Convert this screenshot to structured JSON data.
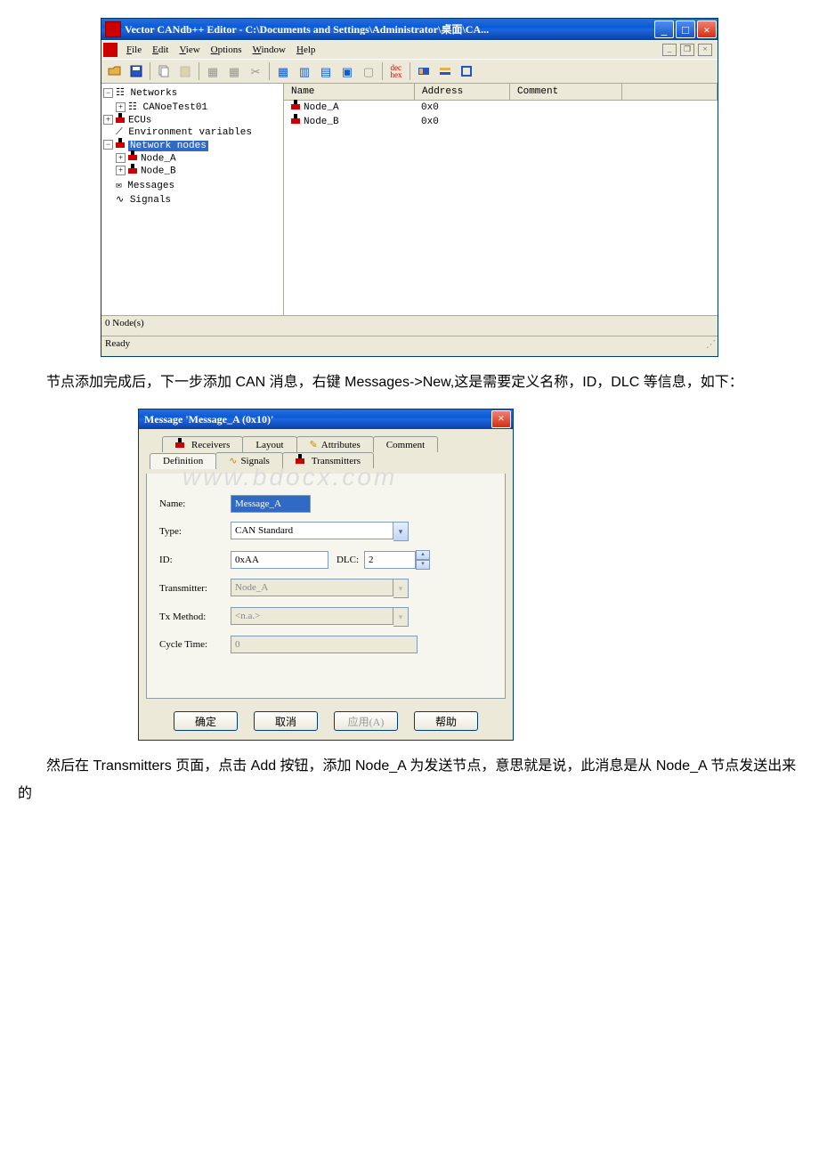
{
  "editor": {
    "title": "Vector CANdb++ Editor - C:\\Documents and Settings\\Administrator\\桌面\\CA...",
    "menus": {
      "file": "File",
      "edit": "Edit",
      "view": "View",
      "options": "Options",
      "window": "Window",
      "help": "Help"
    },
    "tree": {
      "networks": "Networks",
      "canoetest": "CANoeTest01",
      "ecus": "ECUs",
      "env": "Environment variables",
      "netnodes": "Network nodes",
      "node_a": "Node_A",
      "node_b": "Node_B",
      "msgs": "Messages",
      "sigs": "Signals"
    },
    "list": {
      "h_name": "Name",
      "h_addr": "Address",
      "h_comm": "Comment",
      "rows": [
        {
          "name": "Node_A",
          "addr": "0x0"
        },
        {
          "name": "Node_B",
          "addr": "0x0"
        }
      ]
    },
    "status_nodes": "0  Node(s)",
    "status_ready": "Ready"
  },
  "para1": "节点添加完成后，下一步添加 CAN 消息，右键 Messages->New,这是需要定义名称，ID，DLC 等信息，如下：",
  "dialog": {
    "title": "Message 'Message_A (0x10)'",
    "tabs": {
      "receivers": "Receivers",
      "layout": "Layout",
      "attributes": "Attributes",
      "comment": "Comment",
      "definition": "Definition",
      "signals": "Signals",
      "transmitters": "Transmitters"
    },
    "labels": {
      "name": "Name:",
      "type": "Type:",
      "id": "ID:",
      "dlc": "DLC:",
      "transmitter": "Transmitter:",
      "txmethod": "Tx Method:",
      "cycle": "Cycle Time:"
    },
    "values": {
      "name": "Message_A",
      "type": "CAN Standard",
      "id": "0xAA",
      "dlc": "2",
      "transmitter": "Node_A",
      "txmethod": "<n.a.>",
      "cycle": "0"
    },
    "buttons": {
      "ok": "确定",
      "cancel": "取消",
      "apply": "应用(A)",
      "help": "帮助"
    },
    "watermark": "www.bdocx.com"
  },
  "para2": "然后在 Transmitters 页面，点击 Add 按钮，添加 Node_A 为发送节点，意思就是说，此消息是从 Node_A 节点发送出来的"
}
